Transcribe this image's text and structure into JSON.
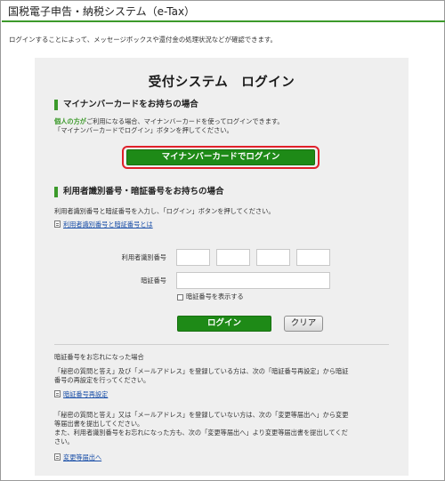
{
  "header": {
    "title": "国税電子申告・納税システム（e-Tax）"
  },
  "intro": "ログインすることによって、メッセージボックスや還付金の処理状況などが確認できます。",
  "panel": {
    "title": "受付システム　ログイン",
    "mynumber": {
      "heading": "マイナンバーカードをお持ちの場合",
      "line1_highlight": "個人の方が",
      "line1_rest": "ご利用になる場合、マイナンバーカードを使ってログインできます。",
      "line2": "「マイナンバーカードでログイン」ボタンを押してください。",
      "button_label": "マイナンバーカードでログイン"
    },
    "userid": {
      "heading": "利用者識別番号・暗証番号をお持ちの場合",
      "description": "利用者識別番号と暗証番号を入力し、「ログイン」ボタンを押してください。",
      "help_link": "利用者識別番号と暗証番号とは",
      "userid_label": "利用者識別番号",
      "password_label": "暗証番号",
      "show_password_label": "暗証番号を表示する",
      "login_label": "ログイン",
      "clear_label": "クリア"
    },
    "forgot": {
      "heading": "暗証番号をお忘れになった場合",
      "para1_line1": "「秘密の質問と答え」及び「メールアドレス」を登録している方は、次の「暗証番号再設定」から暗証",
      "para1_line2": "番号の再設定を行ってください。",
      "reset_link": "暗証番号再設定",
      "para2_line1": "「秘密の質問と答え」又は「メールアドレス」を登録していない方は、次の「変更等届出へ」から変更",
      "para2_line2": "等届出書を提出してください。",
      "para2_line3": "また、利用者識別番号をお忘れになった方も、次の「変更等届出へ」より変更等届出書を提出してくだ",
      "para2_line4": "さい。",
      "change_link": "変更等届出へ"
    }
  },
  "colors": {
    "accent_green": "#3c9a2b",
    "button_green": "#1e8a17",
    "highlight_red": "#e0202a",
    "link_blue": "#1a4fa8"
  }
}
